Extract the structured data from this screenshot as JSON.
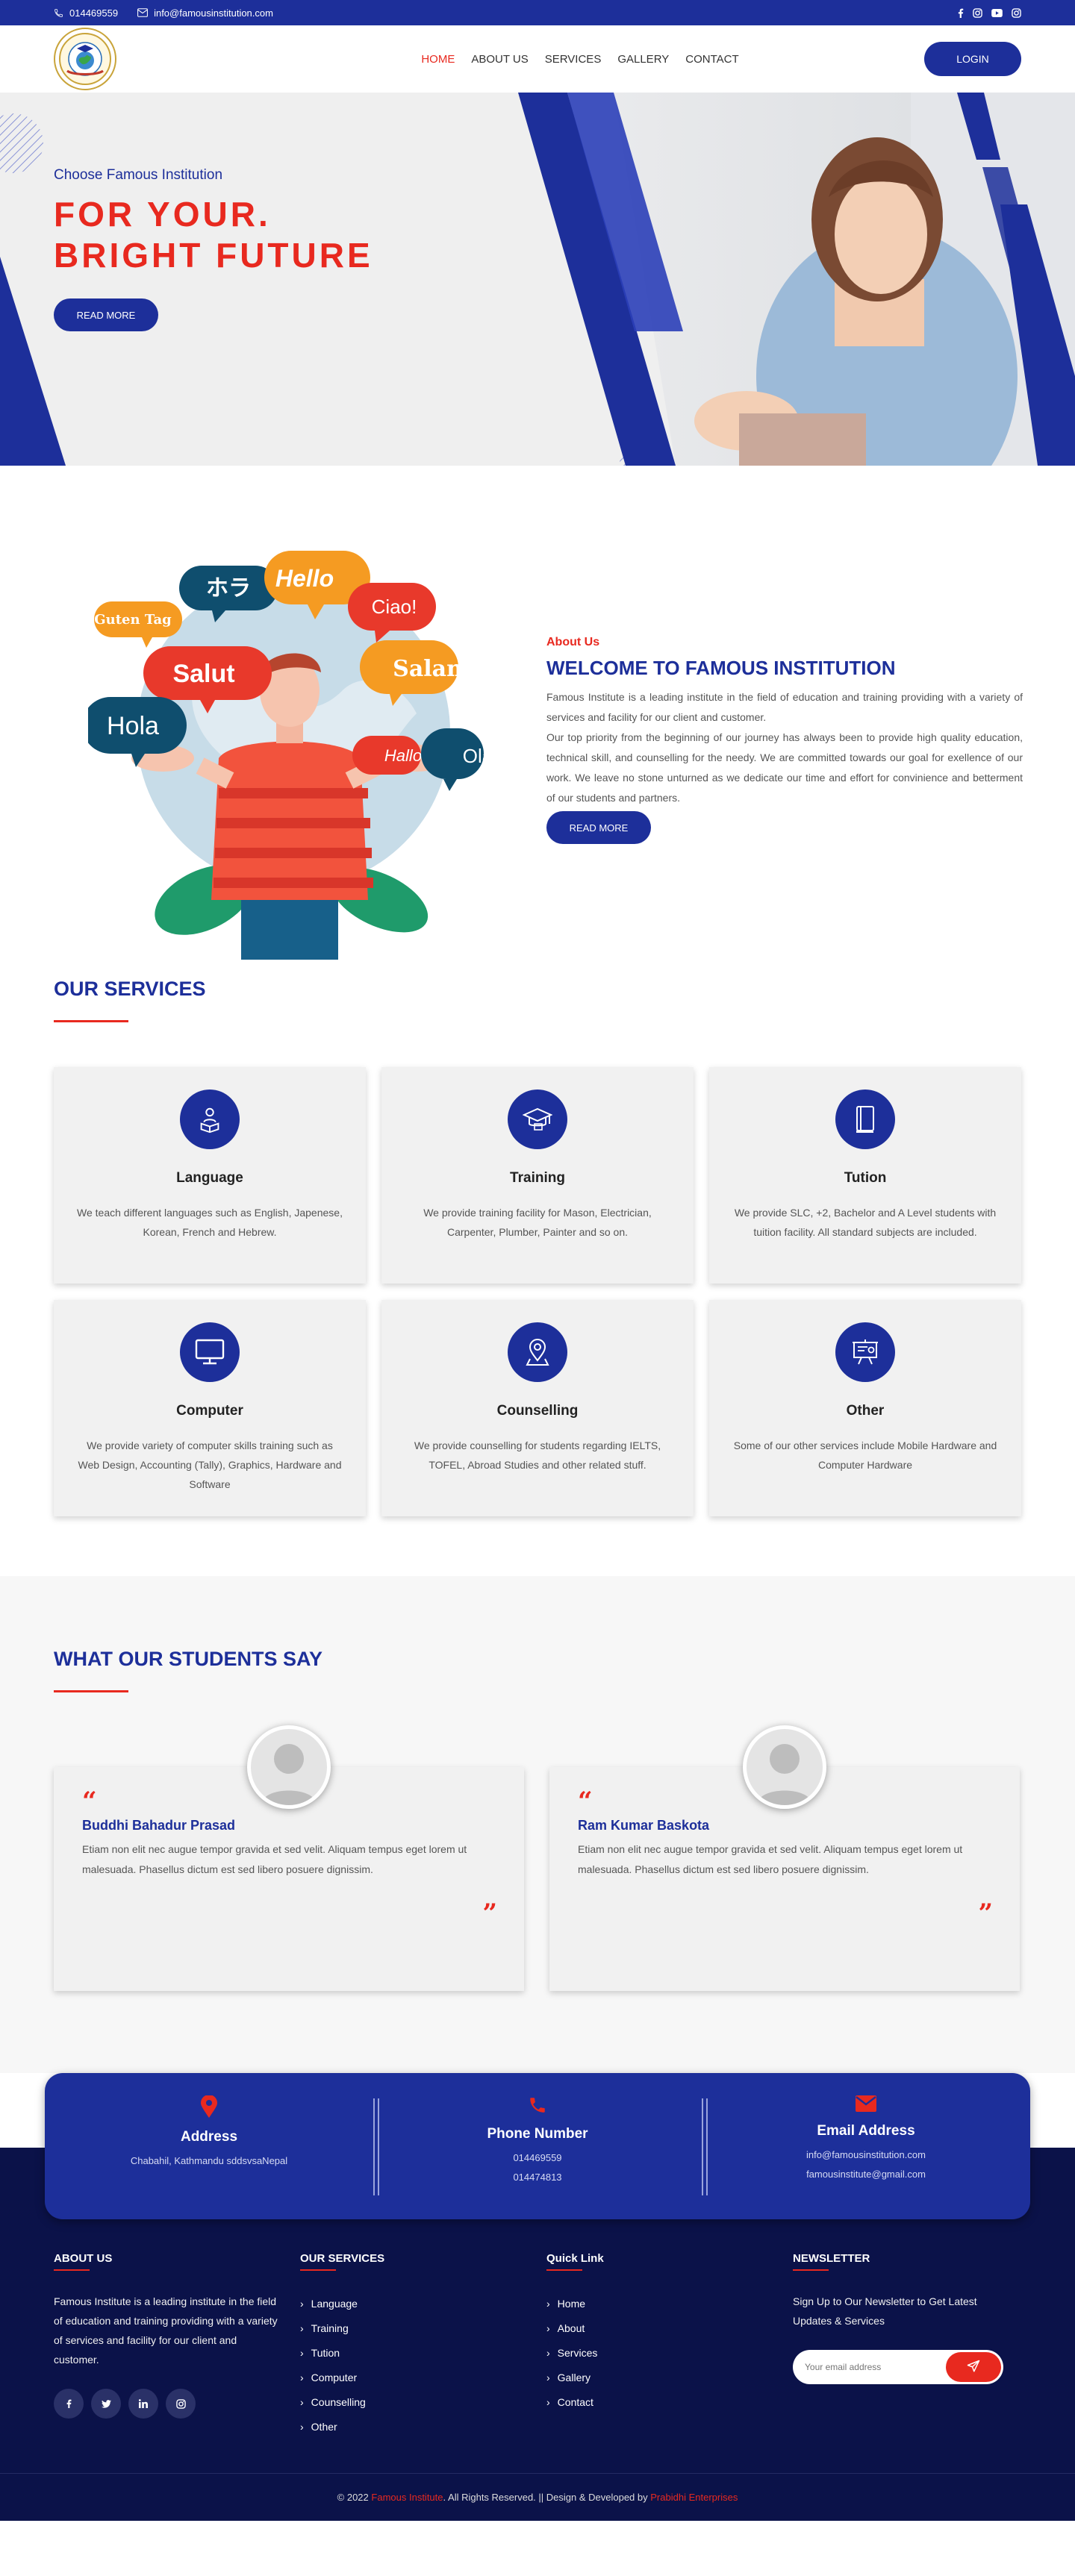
{
  "topbar": {
    "phone": "014469559",
    "email": "info@famousinstitution.com"
  },
  "brand": {
    "logo_text": "FAMOUS INSTITUTE"
  },
  "nav": {
    "items": [
      "HOME",
      "ABOUT US",
      "SERVICES",
      "GALLERY",
      "CONTACT"
    ],
    "login": "LOGIN"
  },
  "hero": {
    "kicker": "Choose Famous Institution",
    "title_line1": "FOR YOUR.",
    "title_line2": "BRIGHT FUTURE",
    "button": "READ MORE"
  },
  "about": {
    "eyebrow": "About Us",
    "title": "WELCOME TO FAMOUS INSTITUTION",
    "para1": "Famous Institute is a leading institute in the field of education and training providing with a variety of services and facility for our client and customer.",
    "para2": "Our top priority from the beginning of our journey has always been to provide high quality education, technical skill, and counselling for the needy. We are committed towards our goal for exellence of our work. We leave no stone unturned as we dedicate our time and effort for convinience and betterment of our students and partners.",
    "button": "READ MORE",
    "bubbles": [
      "ホラ",
      "Hello",
      "Ciao!",
      "Guten Tag",
      "Salut",
      "Salam",
      "Hola",
      "Hallo",
      "Olá"
    ]
  },
  "services": {
    "title": "OUR SERVICES",
    "items": [
      {
        "icon": "reading-person-icon",
        "title": "Language",
        "text": "We teach different languages such as English, Japenese, Korean, French and Hebrew."
      },
      {
        "icon": "graduation-cap-icon",
        "title": "Training",
        "text": "We provide training facility for Mason, Electrician, Carpenter, Plumber, Painter and so on."
      },
      {
        "icon": "book-icon",
        "title": "Tution",
        "text": "We provide SLC, +2, Bachelor and A Level students with tuition facility. All standard subjects are included."
      },
      {
        "icon": "monitor-icon",
        "title": "Computer",
        "text": "We provide variety of computer skills training such as Web Design, Accounting (Tally), Graphics, Hardware and Software"
      },
      {
        "icon": "map-pin-icon",
        "title": "Counselling",
        "text": "We provide counselling for students regarding IELTS, TOFEL, Abroad Studies and other related stuff."
      },
      {
        "icon": "presentation-board-icon",
        "title": "Other",
        "text": "Some of our other services include Mobile Hardware and Computer Hardware"
      }
    ]
  },
  "testimonials": {
    "title": "WHAT OUR STUDENTS SAY",
    "items": [
      {
        "name": "Buddhi Bahadur Prasad",
        "text": "Etiam non elit nec augue tempor gravida et sed velit. Aliquam tempus eget lorem ut malesuada. Phasellus dictum est sed libero posuere dignissim."
      },
      {
        "name": "Ram Kumar Baskota",
        "text": "Etiam non elit nec augue tempor gravida et sed velit. Aliquam tempus eget lorem ut malesuada. Phasellus dictum est sed libero posuere dignissim."
      }
    ]
  },
  "contact": {
    "address_title": "Address",
    "address": "Chabahil, Kathmandu sddsvsaNepal",
    "phone_title": "Phone Number",
    "phone1": "014469559",
    "phone2": "014474813",
    "email_title": "Email Address",
    "email1": "info@famousinstitution.com",
    "email2": "famousinstitute@gmail.com"
  },
  "footer": {
    "about_title": "ABOUT US",
    "about_text": "Famous Institute is a leading institute in the field of education and training providing with a variety of services and facility for our client and customer.",
    "services_title": "OUR SERVICES",
    "services": [
      "Language",
      "Training",
      "Tution",
      "Computer",
      "Counselling",
      "Other"
    ],
    "quick_title": "Quick Link",
    "quick": [
      "Home",
      "About",
      "Services",
      "Gallery",
      "Contact"
    ],
    "news_title": "NEWSLETTER",
    "news_text": "Sign Up to Our Newsletter to Get Latest Updates & Services",
    "news_placeholder": "Your email address",
    "copy_pre": "© 2022",
    "copy_brand": "Famous Institute",
    "copy_mid": ". All Rights Reserved. || Design & Developed by",
    "copy_dev": "Prabidhi Enterprises"
  },
  "colors": {
    "primary": "#1d2f9a",
    "accent": "#e8291f",
    "footer_bg": "#0b1249"
  }
}
